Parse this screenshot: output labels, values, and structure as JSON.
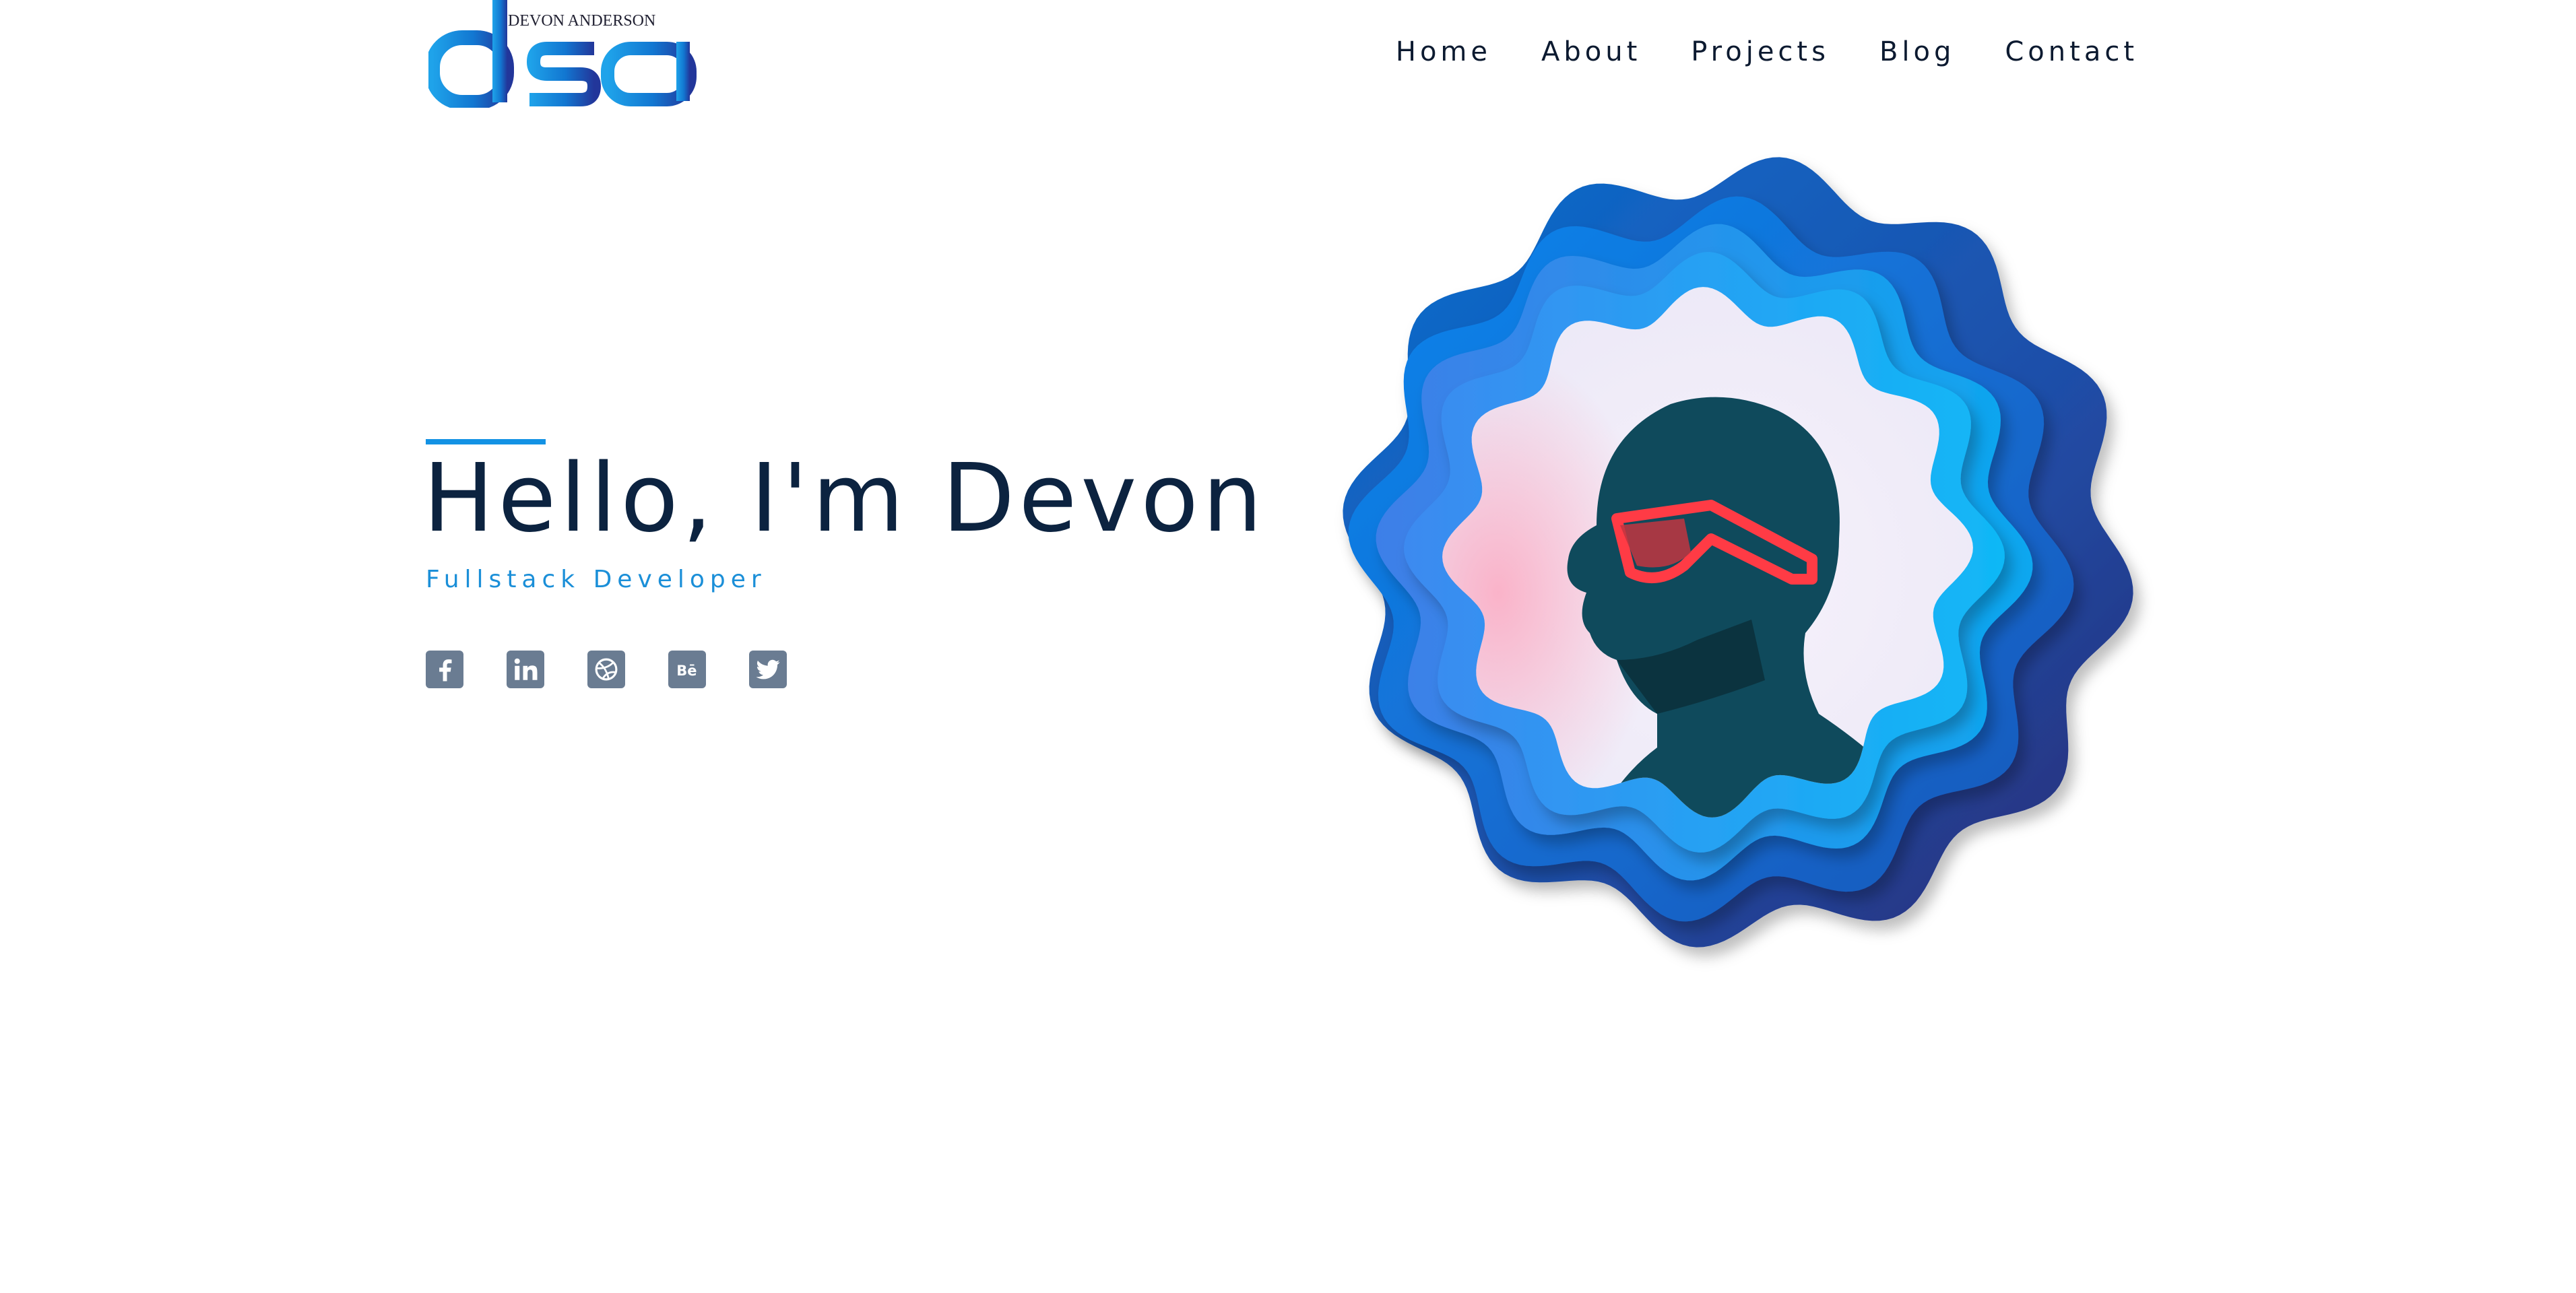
{
  "logo": {
    "letters": "dsa",
    "name": "DEVON ANDERSON"
  },
  "nav": {
    "items": [
      {
        "label": "Home"
      },
      {
        "label": "About"
      },
      {
        "label": "Projects"
      },
      {
        "label": "Blog"
      },
      {
        "label": "Contact"
      }
    ]
  },
  "hero": {
    "title": "Hello, I'm Devon",
    "subtitle": "Fullstack Developer"
  },
  "social": {
    "icons": [
      "facebook-icon",
      "linkedin-icon",
      "dribbble-icon",
      "behance-icon",
      "twitter-icon"
    ]
  },
  "colors": {
    "accent": "#1392e4",
    "title": "#0c2340",
    "nav_text": "#0c1a30",
    "icon_bg": "#6a7c92"
  }
}
